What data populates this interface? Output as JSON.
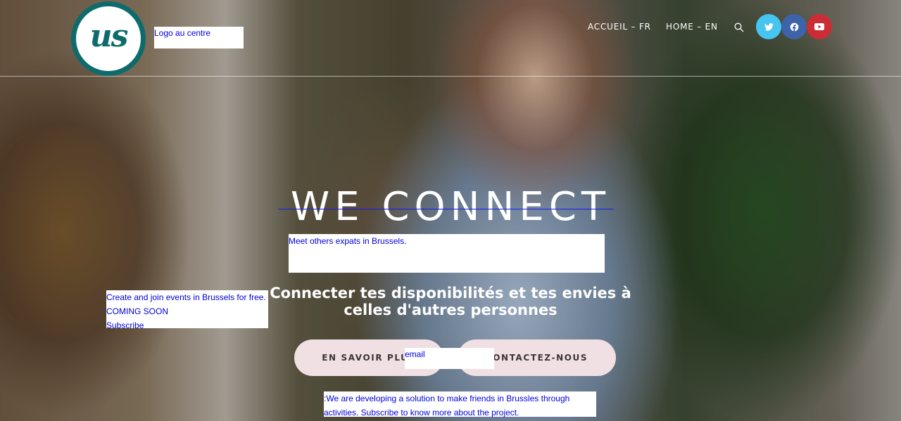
{
  "header": {
    "logo_text": "us",
    "logo_caption": "Logo au centre",
    "nav": [
      {
        "label": "ACCUEIL – FR"
      },
      {
        "label": "HOME – EN"
      }
    ],
    "social": [
      "twitter-icon",
      "facebook-icon",
      "youtube-icon"
    ],
    "colors": {
      "twitter": "#46c4f2",
      "facebook": "#3d63a8",
      "youtube": "#cc2c34",
      "logo": "#0e6b6b"
    }
  },
  "hero": {
    "title": "WE CONNECT",
    "tagline": "Meet others expats in Brussels.",
    "events": {
      "line1": "Create and join events in Brussels for free.",
      "line2": "COMING SOON",
      "line3": "Subscribe"
    },
    "subheadline": "Connecter tes disponibilités et tes envies à celles d'autres personnes",
    "buttons": {
      "more": "EN SAVOIR PLUS",
      "contact": "CONTACTEZ-NOUS"
    },
    "email_placeholder": "email",
    "project_text": ":We are developing a solution to make friends in Brussles through activities. Subscribe to know more about the project.",
    "button_color": "#f1e0e3"
  }
}
